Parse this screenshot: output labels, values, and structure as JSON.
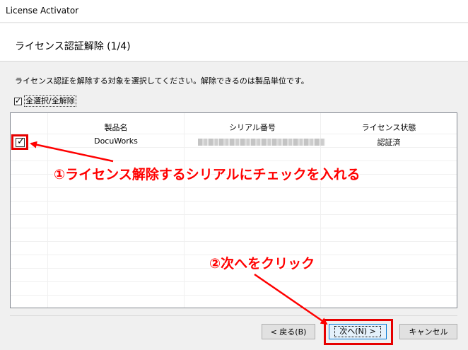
{
  "window": {
    "title": "License Activator"
  },
  "header": {
    "step_title": "ライセンス認証解除 (1/4)"
  },
  "instruction": "ライセンス認証を解除する対象を選択してください。解除できるのは製品単位です。",
  "select_all": {
    "label": "全選択/全解除",
    "checked": true
  },
  "table": {
    "columns": [
      "製品名",
      "シリアル番号",
      "ライセンス状態"
    ],
    "rows": [
      {
        "checked": true,
        "product": "DocuWorks",
        "status": "認証済"
      }
    ]
  },
  "annotations": {
    "step1": "①ライセンス解除するシリアルにチェックを入れる",
    "step2": "②次へをクリック",
    "color": "#ff0000"
  },
  "buttons": {
    "back": "< 戻る(B)",
    "next": "次へ(N) >",
    "cancel": "キャンセル"
  }
}
